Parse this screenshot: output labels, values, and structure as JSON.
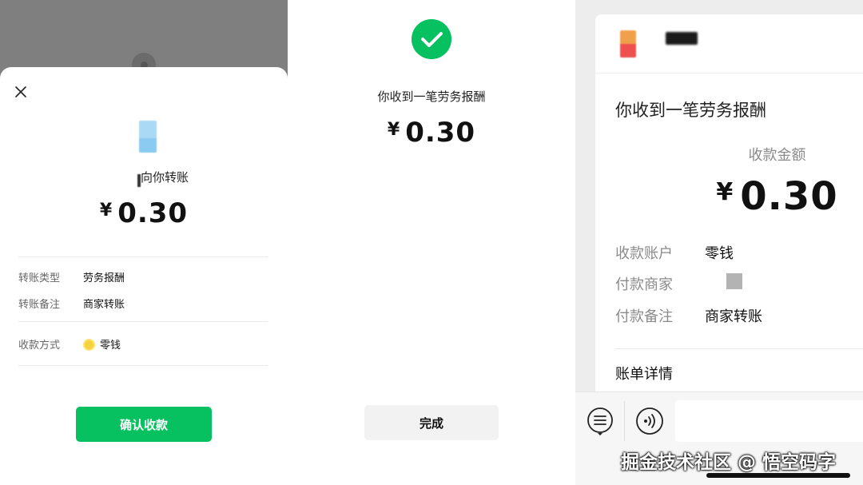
{
  "panel1": {
    "to_you_text": "向你转账",
    "amount": "0.30",
    "currency_symbol": "¥",
    "rows": [
      {
        "label": "转账类型",
        "value": "劳务报酬"
      },
      {
        "label": "转账备注",
        "value": "商家转账"
      },
      {
        "label": "收款方式",
        "value": "零钱"
      }
    ],
    "confirm_button": "确认收款",
    "colors": {
      "accent": "#07c160"
    },
    "icons": {
      "close": "close-icon",
      "coin": "coin-icon"
    }
  },
  "panel2": {
    "title": "你收到一笔劳务报酬",
    "amount": "0.30",
    "currency_symbol": "¥",
    "done_button": "完成",
    "icons": {
      "success": "check-circle-icon"
    }
  },
  "panel3": {
    "title": "你收到一笔劳务报酬",
    "amount_label": "收款金额",
    "amount": "0.30",
    "currency_symbol": "¥",
    "rows": [
      {
        "label": "收款账户",
        "value": "零钱"
      },
      {
        "label": "付款商家",
        "value": ""
      },
      {
        "label": "付款备注",
        "value": "商家转账"
      }
    ],
    "bill_details": "账单详情",
    "watermark": "掘金技术社区 @ 悟空码字",
    "icons": {
      "menu": "list-menu-icon",
      "voice": "voice-icon"
    }
  }
}
